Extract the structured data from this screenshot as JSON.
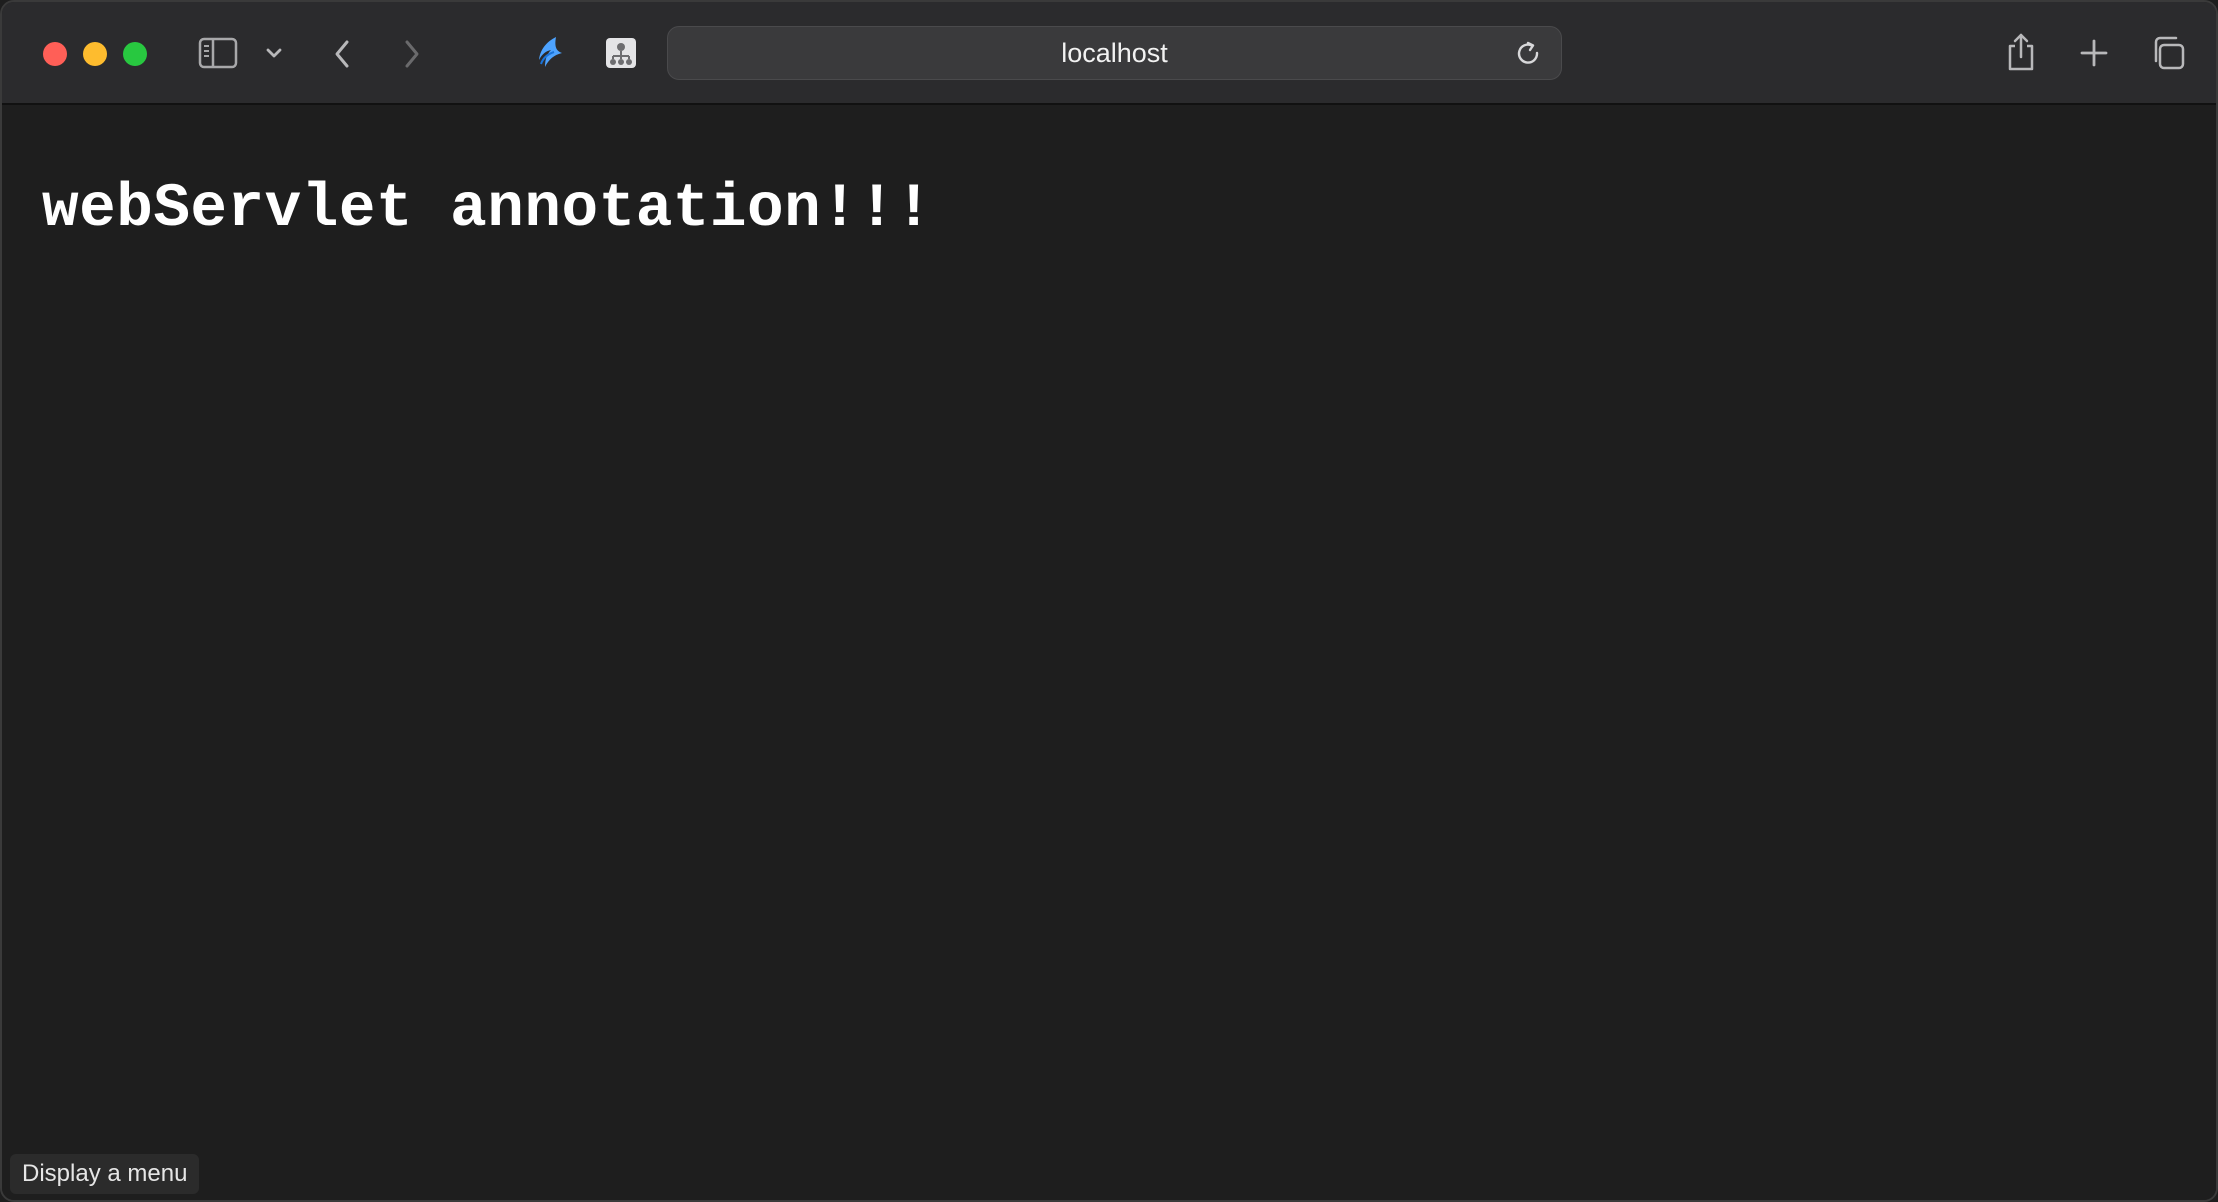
{
  "browser": {
    "address": "localhost",
    "icons": {
      "sidebar": "sidebar-icon",
      "sidebar_menu": "chevron-down-icon",
      "back": "chevron-left-icon",
      "forward": "chevron-right-icon",
      "extension_1": "bird-extension-icon",
      "extension_2": "sitemap-extension-icon",
      "reload": "reload-icon",
      "share": "share-icon",
      "new_tab": "plus-icon",
      "tab_overview": "tabs-overview-icon"
    },
    "traffic_colors": {
      "close": "#ff5f57",
      "minimize": "#febc2e",
      "maximize": "#28c840"
    }
  },
  "page": {
    "heading": "webServlet annotation!!!"
  },
  "status_bar": {
    "text": "Display a menu"
  }
}
